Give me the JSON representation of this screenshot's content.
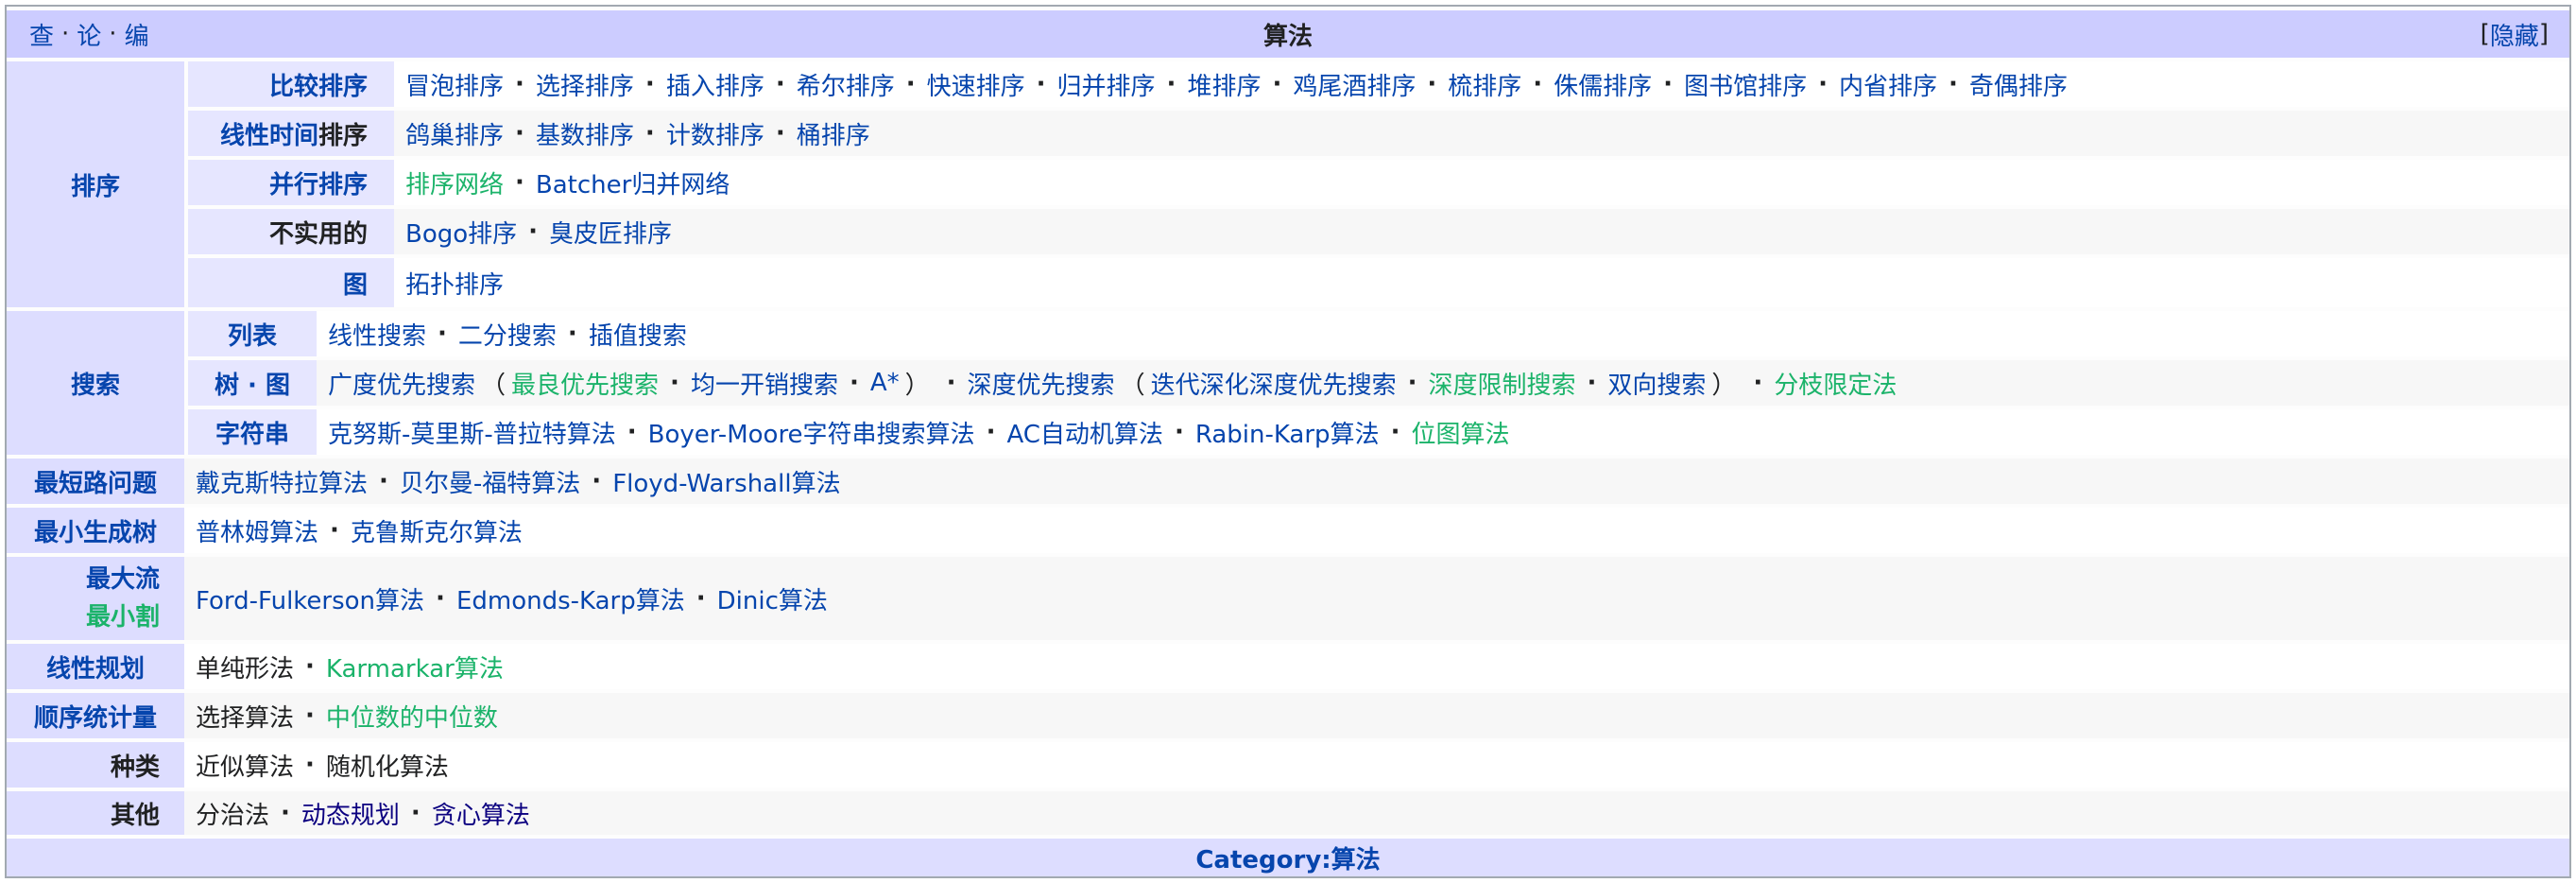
{
  "header": {
    "vte": [
      "查",
      "论",
      "编"
    ],
    "title": "算法",
    "hide_open": "[",
    "hide_label": "隐藏",
    "hide_close": "]"
  },
  "groups": {
    "sorting": {
      "label": "排序",
      "rows": [
        {
          "label": "比较排序",
          "items": [
            "冒泡排序",
            "选择排序",
            "插入排序",
            "希尔排序",
            "快速排序",
            "归并排序",
            "堆排序",
            "鸡尾酒排序",
            "梳排序",
            "侏儒排序",
            "图书馆排序",
            "内省排序",
            "奇偶排序"
          ]
        },
        {
          "label_linked": "线性时间",
          "label_plain": "排序",
          "items": [
            "鸽巢排序",
            "基数排序",
            "计数排序",
            "桶排序"
          ]
        },
        {
          "label": "并行排序",
          "items": [
            "排序网络",
            "Batcher归并网络"
          ]
        },
        {
          "label": "不实用的",
          "items": [
            "Bogo排序",
            "臭皮匠排序"
          ]
        },
        {
          "label": "图",
          "items": [
            "拓扑排序"
          ]
        }
      ]
    },
    "search": {
      "label": "搜索",
      "rows": [
        {
          "label": "列表",
          "items": [
            "线性搜索",
            "二分搜索",
            "插值搜索"
          ]
        },
        {
          "label": "树 · 图",
          "items": [
            "广度优先搜索",
            "最良优先搜索",
            "均一开销搜索",
            "A*",
            "深度优先搜索",
            "迭代深化深度优先搜索",
            "深度限制搜索",
            "双向搜索",
            "分枝限定法"
          ],
          "parens": [
            "（",
            "）",
            "（",
            "）"
          ]
        },
        {
          "label": "字符串",
          "items": [
            "克努斯-莫里斯-普拉特算法",
            "Boyer-Moore字符串搜索算法",
            "AC自动机算法",
            "Rabin-Karp算法",
            "位图算法"
          ]
        }
      ]
    },
    "shortest_path": {
      "label": "最短路问题",
      "items": [
        "戴克斯特拉算法",
        "贝尔曼-福特算法",
        "Floyd-Warshall算法"
      ]
    },
    "mst": {
      "label": "最小生成树",
      "items": [
        "普林姆算法",
        "克鲁斯克尔算法"
      ]
    },
    "maxflow": {
      "label1": "最大流",
      "label2": "最小割",
      "items": [
        "Ford-Fulkerson算法",
        "Edmonds-Karp算法",
        "Dinic算法"
      ]
    },
    "lp": {
      "label": "线性规划",
      "items": [
        "单纯形法",
        "Karmarkar算法"
      ]
    },
    "order_stat": {
      "label": "顺序统计量",
      "items": [
        "选择算法",
        "中位数的中位数"
      ]
    },
    "kinds": {
      "label": "种类",
      "items": [
        "近似算法",
        "随机化算法"
      ]
    },
    "other": {
      "label": "其他",
      "items": [
        "分治法",
        "动态规划",
        "贪心算法"
      ]
    }
  },
  "footer": {
    "label": "Category:算法"
  },
  "colors": {
    "link": "#0645ad",
    "new_link": "#1bb36a",
    "visited": "#0b0080",
    "title_bg": "#ccccff",
    "group_bg": "#ddddff"
  }
}
